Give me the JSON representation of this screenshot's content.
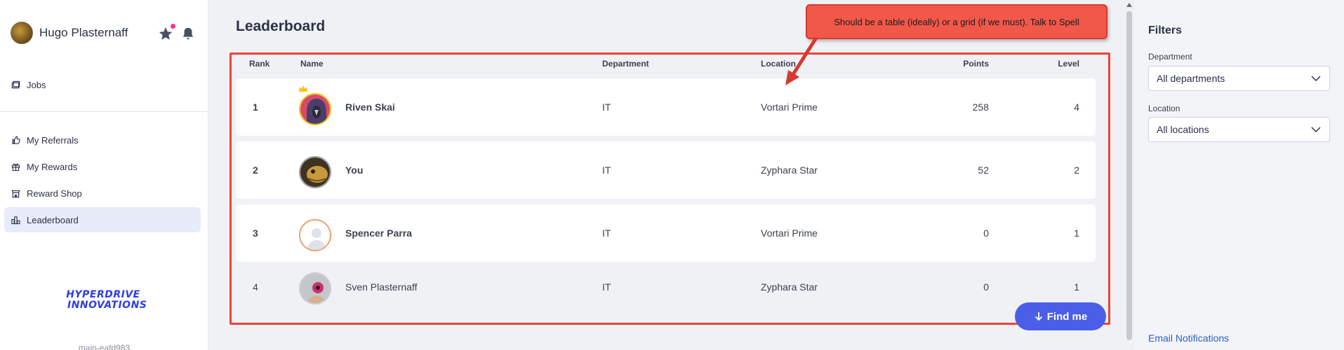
{
  "sidebar": {
    "user_name": "Hugo Plasternaff",
    "items": [
      {
        "label": "Jobs"
      },
      {
        "label": "My Referrals"
      },
      {
        "label": "My Rewards"
      },
      {
        "label": "Reward Shop"
      },
      {
        "label": "Leaderboard",
        "active": true
      }
    ],
    "logo_line1": "HYPERDRIVE",
    "logo_line2": "INNOVATIONS",
    "version": "main-eafd983"
  },
  "main": {
    "title": "Leaderboard",
    "columns": {
      "rank": "Rank",
      "name": "Name",
      "department": "Department",
      "location": "Location",
      "points": "Points",
      "level": "Level"
    },
    "rows": [
      {
        "rank": "1",
        "name": "Riven Skai",
        "department": "IT",
        "location": "Vortari Prime",
        "points": "258",
        "level": "4"
      },
      {
        "rank": "2",
        "name": "You",
        "department": "IT",
        "location": "Zyphara Star",
        "points": "52",
        "level": "2"
      },
      {
        "rank": "3",
        "name": "Spencer Parra",
        "department": "IT",
        "location": "Vortari Prime",
        "points": "0",
        "level": "1"
      },
      {
        "rank": "4",
        "name": "Sven Plasternaff",
        "department": "IT",
        "location": "Zyphara Star",
        "points": "0",
        "level": "1"
      }
    ],
    "find_me": "Find me"
  },
  "annotation": {
    "text": "Should be a table (ideally) or a grid (if we must). Talk to Spell"
  },
  "filters": {
    "title": "Filters",
    "department_label": "Department",
    "department_value": "All departments",
    "location_label": "Location",
    "location_value": "All locations",
    "email_link": "Email Notifications"
  },
  "colors": {
    "accent": "#4a5ee8",
    "annotation": "#f2584a",
    "notification_dot": "#ff2fa0",
    "logo": "#2e3ee6"
  }
}
